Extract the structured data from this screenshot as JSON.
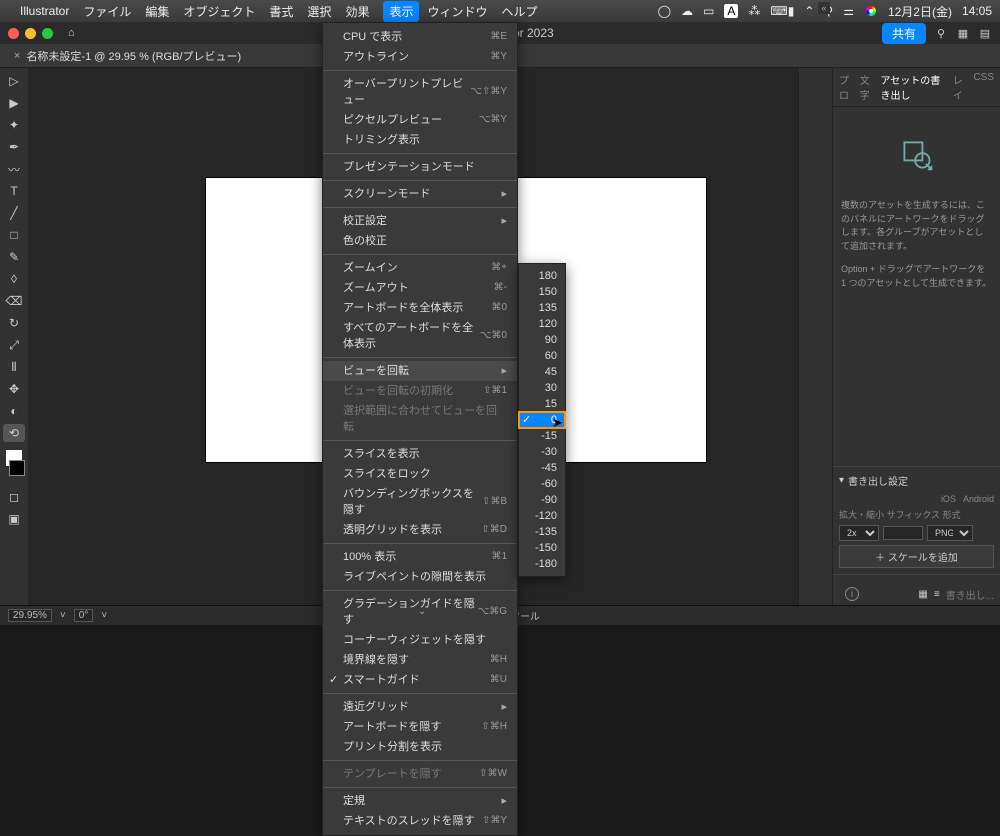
{
  "mac": {
    "app": "Illustrator",
    "menus": [
      "ファイル",
      "編集",
      "オブジェクト",
      "書式",
      "選択",
      "効果",
      "表示",
      "ウィンドウ",
      "ヘルプ"
    ],
    "status_a": "A",
    "date": "12月2日(金)",
    "time": "14:05"
  },
  "titlebar": {
    "title": "or 2023",
    "share": "共有"
  },
  "doc_tab": {
    "name": "名称未設定-1 @ 29.95 % (RGB/プレビュー)"
  },
  "view_menu": {
    "items": [
      {
        "label": "CPU で表示",
        "sc": "⌘E"
      },
      {
        "label": "アウトライン",
        "sc": "⌘Y"
      },
      {
        "sep": true
      },
      {
        "label": "オーバープリントプレビュー",
        "sc": "⌥⇧⌘Y"
      },
      {
        "label": "ピクセルプレビュー",
        "sc": "⌥⌘Y"
      },
      {
        "label": "トリミング表示"
      },
      {
        "sep": true
      },
      {
        "label": "プレゼンテーションモード"
      },
      {
        "sep": true
      },
      {
        "label": "スクリーンモード",
        "arrow": true
      },
      {
        "sep": true
      },
      {
        "label": "校正設定",
        "arrow": true
      },
      {
        "label": "色の校正"
      },
      {
        "sep": true
      },
      {
        "label": "ズームイン",
        "sc": "⌘+"
      },
      {
        "label": "ズームアウト",
        "sc": "⌘-"
      },
      {
        "label": "アートボードを全体表示",
        "sc": "⌘0"
      },
      {
        "label": "すべてのアートボードを全体表示",
        "sc": "⌥⌘0"
      },
      {
        "sep": true
      },
      {
        "label": "ビューを回転",
        "arrow": true,
        "hover": true
      },
      {
        "label": "ビューを回転の初期化",
        "sc": "⇧⌘1",
        "disabled": true
      },
      {
        "label": "選択範囲に合わせてビューを回転",
        "disabled": true
      },
      {
        "sep": true
      },
      {
        "label": "スライスを表示"
      },
      {
        "label": "スライスをロック"
      },
      {
        "label": "バウンディングボックスを隠す",
        "sc": "⇧⌘B"
      },
      {
        "label": "透明グリッドを表示",
        "sc": "⇧⌘D"
      },
      {
        "sep": true
      },
      {
        "label": "100% 表示",
        "sc": "⌘1"
      },
      {
        "label": "ライブペイントの隙間を表示"
      },
      {
        "sep": true
      },
      {
        "label": "グラデーションガイドを隠す",
        "sc": "⌥⌘G"
      },
      {
        "label": "コーナーウィジェットを隠す"
      },
      {
        "label": "境界線を隠す",
        "sc": "⌘H"
      },
      {
        "label": "スマートガイド",
        "sc": "⌘U",
        "check": true
      },
      {
        "sep": true
      },
      {
        "label": "遠近グリッド",
        "arrow": true
      },
      {
        "label": "アートボードを隠す",
        "sc": "⇧⌘H"
      },
      {
        "label": "プリント分割を表示"
      },
      {
        "sep": true
      },
      {
        "label": "テンプレートを隠す",
        "sc": "⇧⌘W",
        "disabled": true
      },
      {
        "sep": true
      },
      {
        "label": "定規",
        "arrow": true
      },
      {
        "label": "テキストのスレッドを隠す",
        "sc": "⇧⌘Y"
      }
    ]
  },
  "rotate_submenu": {
    "values": [
      "180",
      "150",
      "135",
      "120",
      "90",
      "60",
      "45",
      "30",
      "15",
      "0",
      "-15",
      "-30",
      "-45",
      "-60",
      "-90",
      "-120",
      "-135",
      "-150",
      "-180"
    ],
    "selected": "0"
  },
  "right_panel": {
    "tabs": {
      "t1": "プロ",
      "t2": "文字",
      "t3": "アセットの書き出し",
      "t4": "レイ",
      "t5": "CSS"
    },
    "help1": "複数のアセットを生成するには、このパネルにアートワークをドラッグします。各グループがアセットとして追加されます。",
    "help2": "Option + ドラッグでアートワークを 1 つのアセットとして生成できます。",
    "export_hd": "書き出し設定",
    "plat1": "iOS",
    "plat2": "Android",
    "row_labels": "拡大・縮小  サフィックス  形式",
    "scale": "2x",
    "fmt": "PNG",
    "add_scale": "＋ スケールを追加",
    "export_btn": "書き出し..."
  },
  "status": {
    "zoom": "29.95%",
    "angle": "0°",
    "tool": "回転ビューツール"
  }
}
